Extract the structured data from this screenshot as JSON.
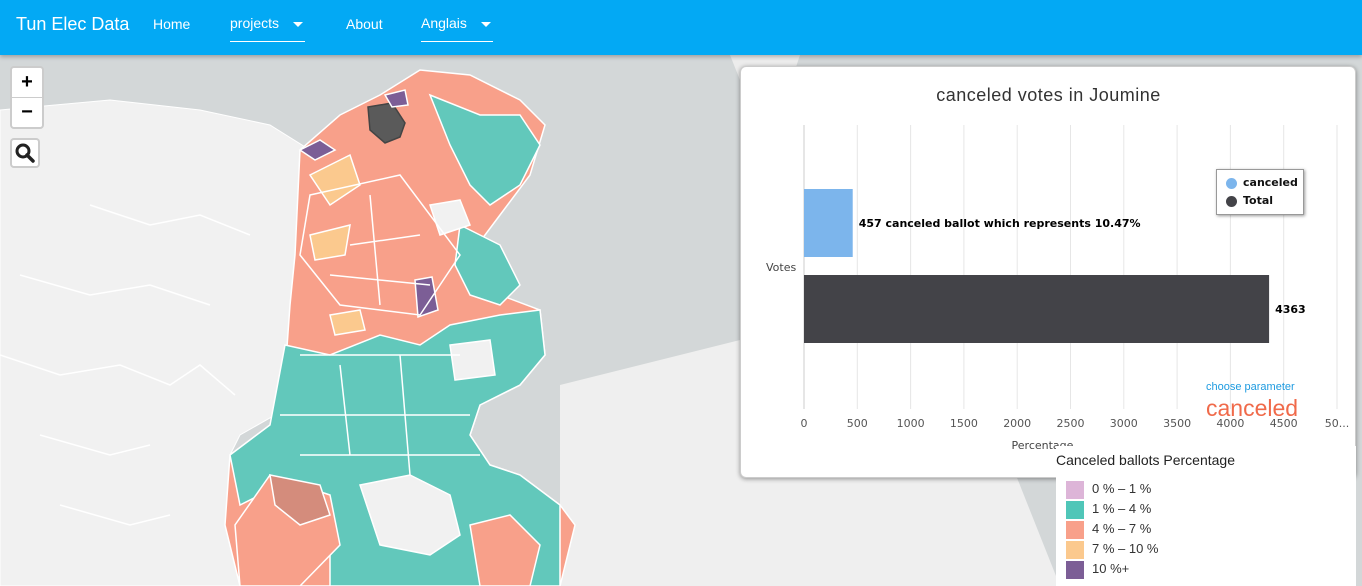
{
  "navbar": {
    "brand": "Tun Elec Data",
    "items": [
      {
        "label": "Home"
      },
      {
        "label": "projects"
      },
      {
        "label": "About"
      },
      {
        "label": "Anglais"
      }
    ]
  },
  "map": {
    "zoom_in_label": "+",
    "zoom_out_label": "−",
    "icons": {
      "search": "search-icon"
    }
  },
  "chart_data": {
    "type": "bar",
    "orientation": "horizontal",
    "title": "canceled votes in Joumine",
    "ylabel": "Votes",
    "xlabel": "Percentage",
    "categories": [
      "canceled",
      "Total"
    ],
    "series": [
      {
        "name": "canceled",
        "color": "#7cb5ec",
        "value": 457,
        "label": "457 canceled ballot which represents 10.47%"
      },
      {
        "name": "Total",
        "color": "#434348",
        "value": 4363,
        "label": "4363"
      }
    ],
    "xlim": [
      0,
      5000
    ],
    "xticks": [
      "0",
      "500",
      "1000",
      "1500",
      "2000",
      "2500",
      "3000",
      "3500",
      "4000",
      "4500",
      "50..."
    ],
    "legend_position": "top-right",
    "grid": true
  },
  "chooser": {
    "label": "choose parameter",
    "value": "canceled",
    "colors": {
      "label": "#1e9be0",
      "value": "#f06a4a"
    }
  },
  "map_legend": {
    "title": "Canceled ballots Percentage",
    "items": [
      {
        "label": "0 % – 1 %",
        "color": "#ddb5d8"
      },
      {
        "label": "1 % – 4 %",
        "color": "#50c6b8"
      },
      {
        "label": "4 % – 7 %",
        "color": "#f8a08a"
      },
      {
        "label": "7 % – 10 %",
        "color": "#fbc98e"
      },
      {
        "label": "10 %+",
        "color": "#7c5e96"
      }
    ]
  },
  "colors": {
    "navbar": "#03a9f4",
    "sea": "#d3d7d8",
    "land": "#f2f2f2"
  }
}
